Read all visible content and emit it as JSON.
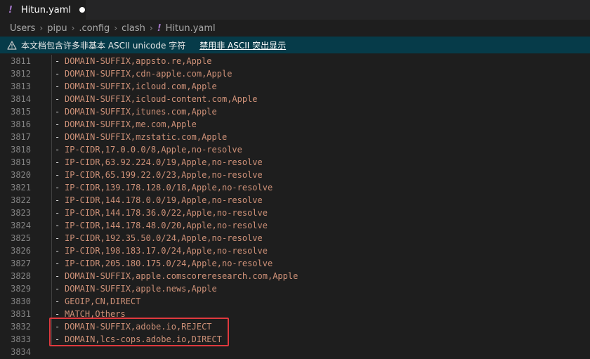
{
  "tab": {
    "icon": "!",
    "label": "Hitun.yaml"
  },
  "breadcrumb": [
    "Users",
    "pipu",
    ".config",
    "clash",
    "Hitun.yaml"
  ],
  "banner": {
    "message": "本文档包含许多非基本 ASCII unicode 字符",
    "action": "禁用非 ASCII 突出显示"
  },
  "editor": {
    "lines": [
      {
        "num": "3811",
        "text": "DOMAIN-SUFFIX,appsto.re,Apple"
      },
      {
        "num": "3812",
        "text": "DOMAIN-SUFFIX,cdn-apple.com,Apple"
      },
      {
        "num": "3813",
        "text": "DOMAIN-SUFFIX,icloud.com,Apple"
      },
      {
        "num": "3814",
        "text": "DOMAIN-SUFFIX,icloud-content.com,Apple"
      },
      {
        "num": "3815",
        "text": "DOMAIN-SUFFIX,itunes.com,Apple"
      },
      {
        "num": "3816",
        "text": "DOMAIN-SUFFIX,me.com,Apple"
      },
      {
        "num": "3817",
        "text": "DOMAIN-SUFFIX,mzstatic.com,Apple"
      },
      {
        "num": "3818",
        "text": "IP-CIDR,17.0.0.0/8,Apple,no-resolve"
      },
      {
        "num": "3819",
        "text": "IP-CIDR,63.92.224.0/19,Apple,no-resolve"
      },
      {
        "num": "3820",
        "text": "IP-CIDR,65.199.22.0/23,Apple,no-resolve"
      },
      {
        "num": "3821",
        "text": "IP-CIDR,139.178.128.0/18,Apple,no-resolve"
      },
      {
        "num": "3822",
        "text": "IP-CIDR,144.178.0.0/19,Apple,no-resolve"
      },
      {
        "num": "3823",
        "text": "IP-CIDR,144.178.36.0/22,Apple,no-resolve"
      },
      {
        "num": "3824",
        "text": "IP-CIDR,144.178.48.0/20,Apple,no-resolve"
      },
      {
        "num": "3825",
        "text": "IP-CIDR,192.35.50.0/24,Apple,no-resolve"
      },
      {
        "num": "3826",
        "text": "IP-CIDR,198.183.17.0/24,Apple,no-resolve"
      },
      {
        "num": "3827",
        "text": "IP-CIDR,205.180.175.0/24,Apple,no-resolve"
      },
      {
        "num": "3828",
        "text": "DOMAIN-SUFFIX,apple.comscoreresearch.com,Apple"
      },
      {
        "num": "3829",
        "text": "DOMAIN-SUFFIX,apple.news,Apple"
      },
      {
        "num": "3830",
        "text": "GEOIP,CN,DIRECT"
      },
      {
        "num": "3831",
        "text": "MATCH,Others"
      },
      {
        "num": "3832",
        "text": "DOMAIN-SUFFIX,adobe.io,REJECT"
      },
      {
        "num": "3833",
        "text": "DOMAIN,lcs-cops.adobe.io,DIRECT"
      },
      {
        "num": "3834",
        "text": ""
      }
    ]
  },
  "colors": {
    "string": "#ce9178",
    "line_number": "#858585",
    "banner_bg": "#063b49",
    "highlight_border": "#e0393e",
    "yaml_icon": "#a074c4"
  },
  "icons": {
    "tab": "yaml-exclamation-icon",
    "dirty": "unsaved-dot-icon",
    "banner": "warning-triangle-icon",
    "separator": "chevron-right-icon"
  }
}
